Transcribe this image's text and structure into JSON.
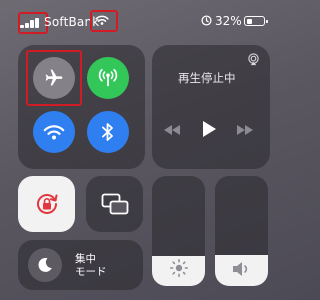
{
  "status_bar": {
    "carrier": "SoftBank",
    "battery_percent": "32%",
    "battery_level": 0.32
  },
  "colors": {
    "highlight": "#d11c25",
    "cellular_active": "#33c659",
    "wifi_active": "#2f7ff1",
    "bluetooth_active": "#2f7ff1",
    "rotation_lock": "#e0383e"
  },
  "connectivity": {
    "airplane_mode": true,
    "cellular_data": true,
    "wifi": true,
    "bluetooth": true
  },
  "media": {
    "title": "再生停止中"
  },
  "focus": {
    "line1": "集中",
    "line2": "モード"
  },
  "sliders": {
    "brightness_level": 0.27,
    "volume_level": 0.28
  },
  "icons": [
    "signal-icon",
    "wifi-icon",
    "alarm-icon",
    "battery-icon",
    "airplane-icon",
    "antenna-icon",
    "bluetooth-icon",
    "airplay-icon",
    "rewind-icon",
    "play-icon",
    "fast-forward-icon",
    "rotation-lock-icon",
    "screen-mirroring-icon",
    "moon-icon",
    "sun-icon",
    "speaker-icon"
  ]
}
